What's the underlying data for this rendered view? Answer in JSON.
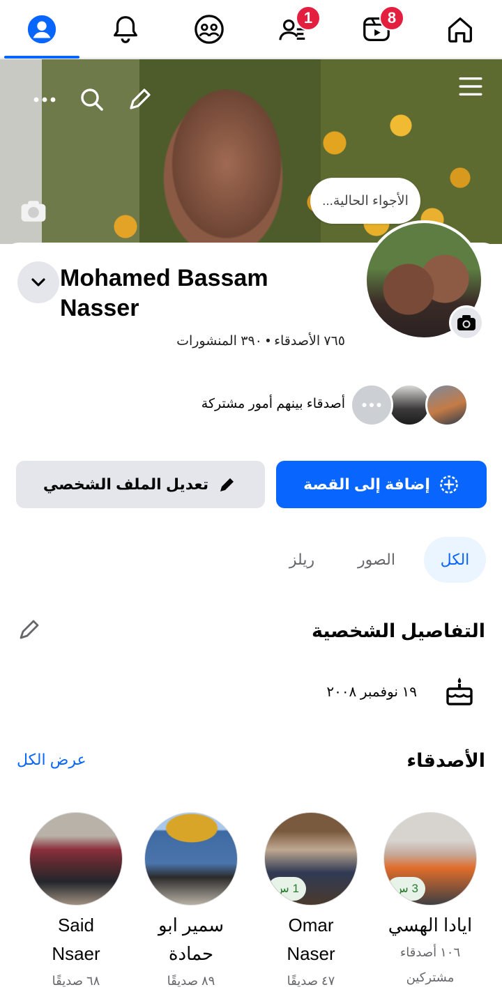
{
  "nav": {
    "badges": {
      "friends": "1",
      "video": "8"
    }
  },
  "cover": {
    "mood_prompt": "الأجواء الحالية..."
  },
  "profile": {
    "name": "Mohamed Bassam Nasser",
    "stats": "٧٦٥ الأصدقاء • ٣٩٠ المنشورات",
    "mutual_text": "أصدقاء بينهم أمور مشتركة"
  },
  "actions": {
    "add_story": "إضافة إلى القصة",
    "edit_profile": "تعديل الملف الشخصي"
  },
  "tabs": [
    {
      "label": "الكل",
      "active": true
    },
    {
      "label": "الصور",
      "active": false
    },
    {
      "label": "ريلز",
      "active": false
    }
  ],
  "details": {
    "title": "التفاصيل الشخصية",
    "birthday": "١٩ نوفمبر ٢٠٠٨"
  },
  "friends": {
    "title": "الأصدقاء",
    "see_all": "عرض الكل",
    "items": [
      {
        "name_line1": "ايادا الهسي",
        "name_line2": "",
        "meta1": "١٠٦ أصدقاء",
        "meta2": "مشتركين",
        "time": "3 س"
      },
      {
        "name_line1": "Omar",
        "name_line2": "Naser",
        "meta1": "٤٧ صديقًا",
        "meta2": "",
        "time": "1 س"
      },
      {
        "name_line1": "سمير ابو",
        "name_line2": "حمادة",
        "meta1": "٨٩ صديقًا",
        "meta2": "",
        "time": ""
      },
      {
        "name_line1": "Said",
        "name_line2": "Nsaer",
        "meta1": "٦٨ صديقًا",
        "meta2": "",
        "time": ""
      }
    ]
  },
  "colors": {
    "accent": "#0866ff",
    "badge": "#e41e3f"
  }
}
